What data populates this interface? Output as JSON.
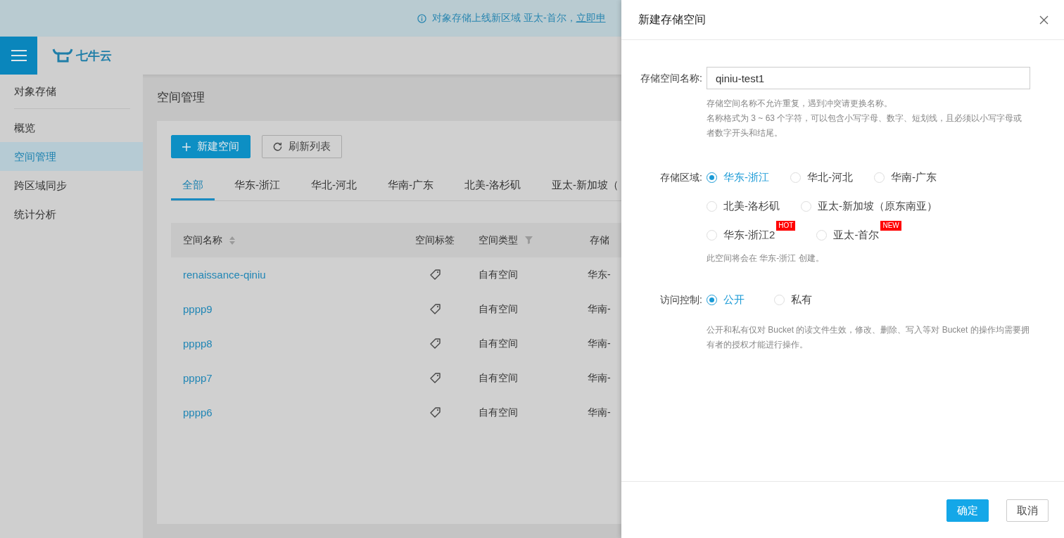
{
  "banner": {
    "text": "对象存储上线新区域 亚太-首尔，",
    "link": "立即申"
  },
  "header": {
    "logo": "七牛云"
  },
  "sidebar": {
    "title": "对象存储",
    "items": [
      {
        "label": "概览",
        "selected": false
      },
      {
        "label": "空间管理",
        "selected": true
      },
      {
        "label": "跨区域同步",
        "selected": false
      },
      {
        "label": "统计分析",
        "selected": false
      }
    ]
  },
  "page": {
    "title": "空间管理"
  },
  "toolbar": {
    "create": "新建空间",
    "refresh": "刷新列表"
  },
  "tabs": [
    {
      "label": "全部",
      "selected": true
    },
    {
      "label": "华东-浙江",
      "selected": false
    },
    {
      "label": "华北-河北",
      "selected": false
    },
    {
      "label": "华南-广东",
      "selected": false
    },
    {
      "label": "北美-洛杉矶",
      "selected": false
    },
    {
      "label": "亚太-新加坡（",
      "selected": false
    }
  ],
  "table": {
    "columns": [
      {
        "label": "空间名称",
        "kind": "sort"
      },
      {
        "label": "空间标签",
        "kind": "plain"
      },
      {
        "label": "空间类型",
        "kind": "filter"
      },
      {
        "label": "存储",
        "kind": "plain"
      }
    ],
    "rows": [
      {
        "name": "renaissance-qiniu",
        "type": "自有空间",
        "region": "华东-"
      },
      {
        "name": "pppp9",
        "type": "自有空间",
        "region": "华南-"
      },
      {
        "name": "pppp8",
        "type": "自有空间",
        "region": "华南-"
      },
      {
        "name": "pppp7",
        "type": "自有空间",
        "region": "华南-"
      },
      {
        "name": "pppp6",
        "type": "自有空间",
        "region": "华南-"
      }
    ]
  },
  "drawer": {
    "title": "新建存储空间",
    "name_field": {
      "label": "存储空间名称:",
      "value": "qiniu-test1",
      "help": [
        "存储空间名称不允许重复，遇到冲突请更换名称。",
        "名称格式为 3 ~ 63 个字符，可以包含小写字母、数字、短划线，且必须以小写字母或者数字开头和结尾。"
      ]
    },
    "region": {
      "label": "存储区域:",
      "options": [
        {
          "label": "华东-浙江",
          "selected": true
        },
        {
          "label": "华北-河北",
          "selected": false
        },
        {
          "label": "华南-广东",
          "selected": false
        },
        {
          "label": "北美-洛杉矶",
          "selected": false
        },
        {
          "label": "亚太-新加坡（原东南亚）",
          "selected": false
        },
        {
          "label": "华东-浙江2",
          "selected": false,
          "badge": "HOT"
        },
        {
          "label": "亚太-首尔",
          "selected": false,
          "badge": "NEW"
        }
      ],
      "help": "此空间将会在 华东-浙江 创建。"
    },
    "access": {
      "label": "访问控制:",
      "options": [
        {
          "label": "公开",
          "selected": true
        },
        {
          "label": "私有",
          "selected": false
        }
      ],
      "help": "公开和私有仅对 Bucket 的读文件生效，修改、删除、写入等对 Bucket 的操作均需要拥有者的授权才能进行操作。"
    },
    "buttons": {
      "ok": "确定",
      "cancel": "取消"
    }
  }
}
